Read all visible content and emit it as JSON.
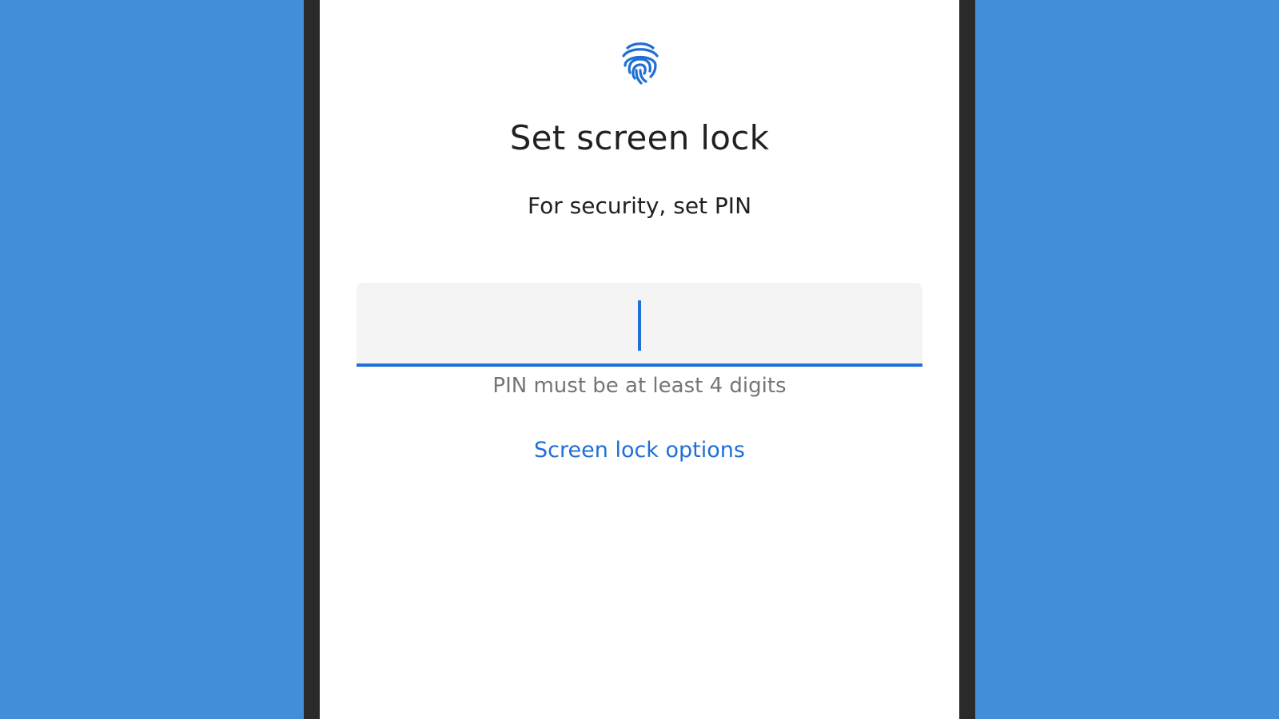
{
  "screen": {
    "icon": "fingerprint-icon",
    "title": "Set screen lock",
    "subtitle": "For security, set PIN",
    "pin_input": {
      "value": "",
      "placeholder": ""
    },
    "hint": "PIN must be at least 4 digits",
    "options_link": "Screen lock options"
  },
  "colors": {
    "background": "#428ed8",
    "bezel": "#2a2a2a",
    "accent": "#1f6fd6",
    "field_bg": "#f4f4f4",
    "text_primary": "#212121",
    "text_secondary": "#757575"
  }
}
